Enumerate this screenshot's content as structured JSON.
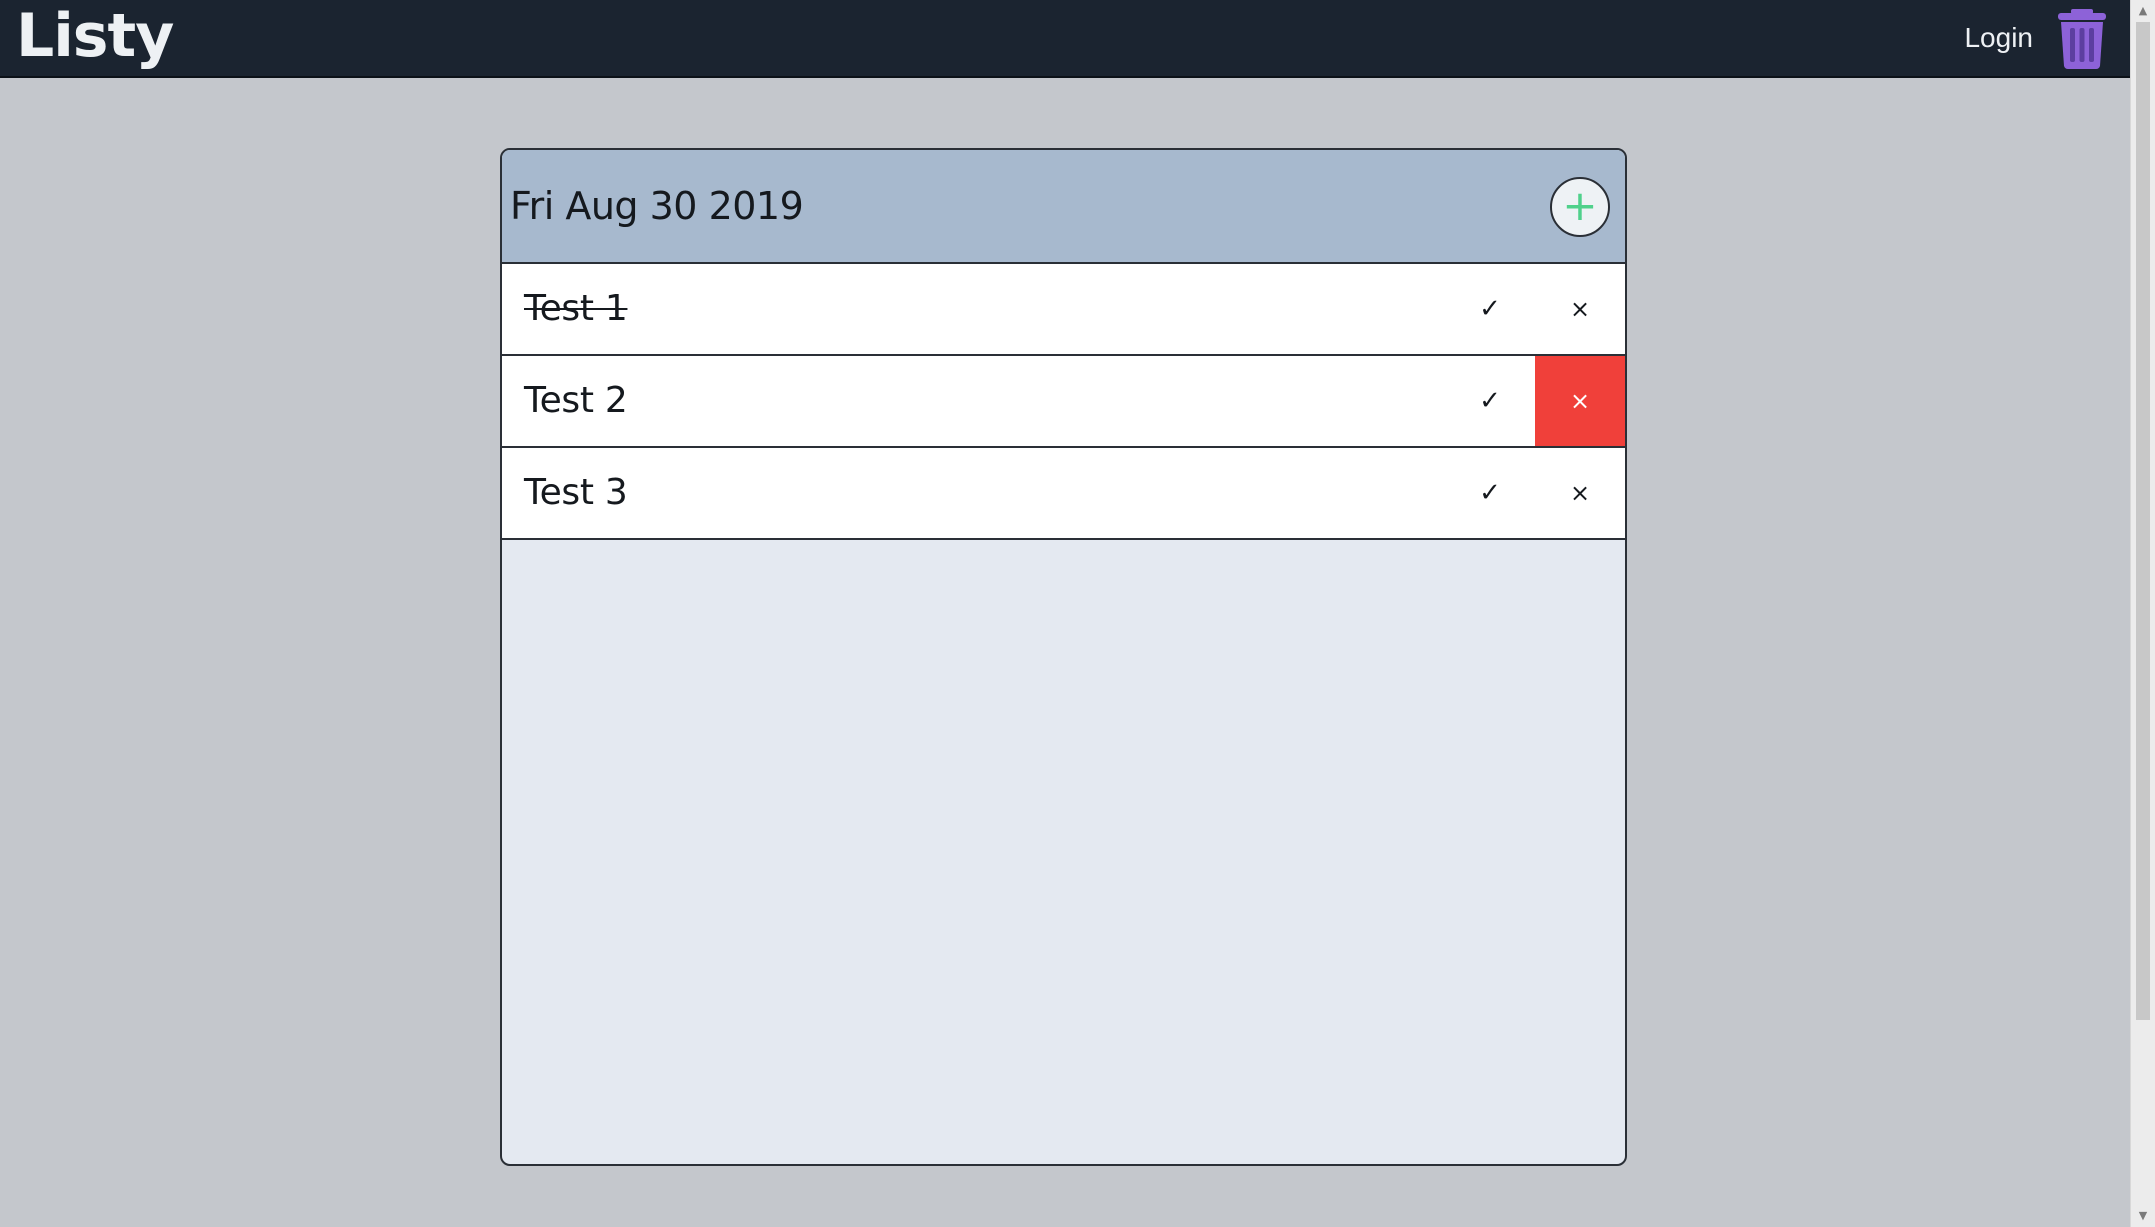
{
  "app": {
    "brand": "Listy",
    "login_label": "Login",
    "trash_icon": "trash-icon",
    "trash_color": "#8d62d8"
  },
  "list": {
    "date_title": "Fri Aug 30 2019",
    "add_icon": "+",
    "add_color": "#4fd18b",
    "items": [
      {
        "label": "Test 1",
        "completed": true,
        "check_icon": "✓",
        "delete_icon": "×",
        "delete_highlighted": false
      },
      {
        "label": "Test 2",
        "completed": false,
        "check_icon": "✓",
        "delete_icon": "×",
        "delete_highlighted": true
      },
      {
        "label": "Test 3",
        "completed": false,
        "check_icon": "✓",
        "delete_icon": "×",
        "delete_highlighted": false
      }
    ]
  },
  "colors": {
    "navbar": "#1b2430",
    "background": "#c4c7cc",
    "card": "#e4e9f1",
    "card_header": "#a7b9ce",
    "delete_hover": "#f0403a"
  },
  "scrollbar": {
    "up_arrow": "▲",
    "down_arrow": "▼"
  }
}
